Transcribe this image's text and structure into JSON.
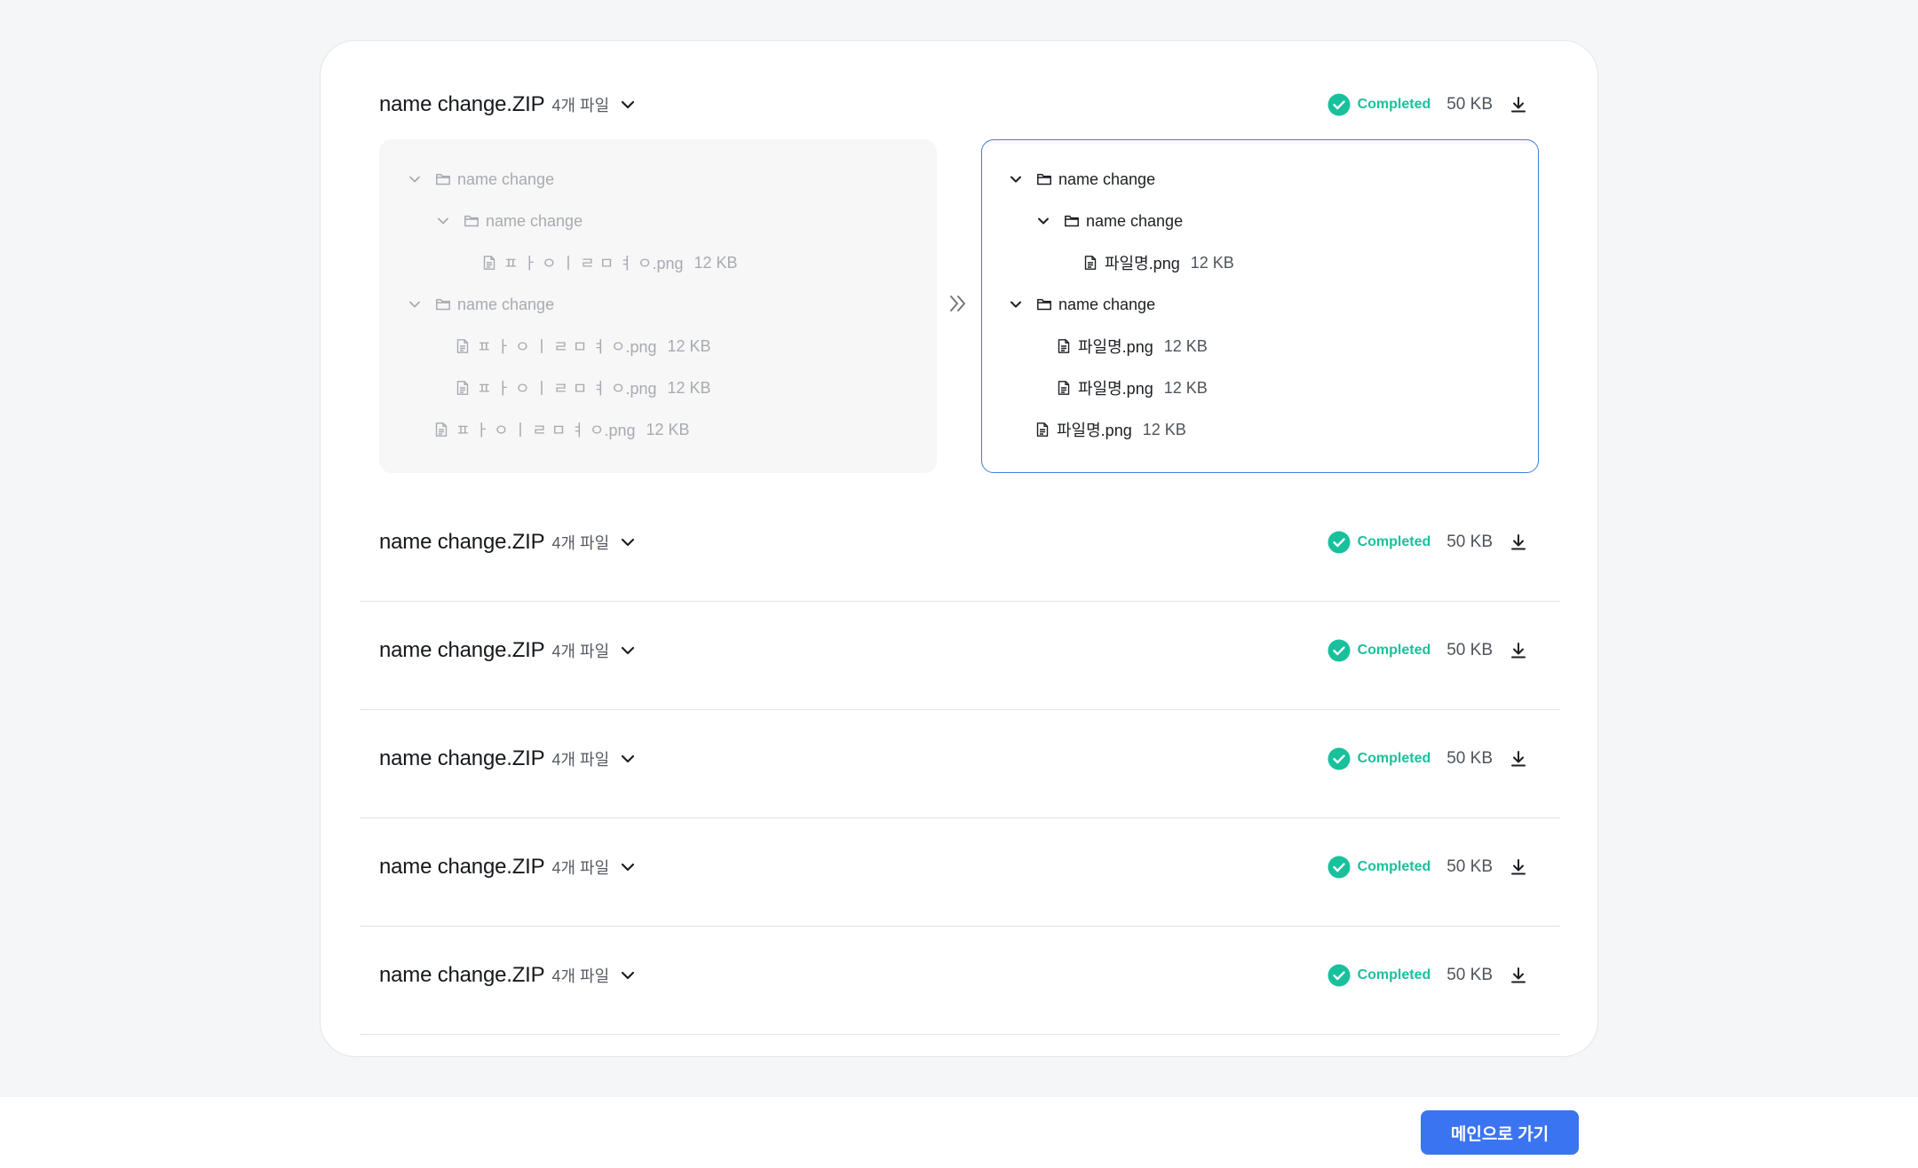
{
  "colors": {
    "accent": "#3b74f0",
    "status_completed": "#18c19c",
    "selected_border": "#3f7de0"
  },
  "files": [
    {
      "name": "name change.ZIP",
      "count": "4개 파일",
      "status": "Completed",
      "size": "50 KB",
      "expanded": true
    },
    {
      "name": "name change.ZIP",
      "count": "4개 파일",
      "status": "Completed",
      "size": "50 KB",
      "expanded": false
    },
    {
      "name": "name change.ZIP",
      "count": "4개 파일",
      "status": "Completed",
      "size": "50 KB",
      "expanded": false
    },
    {
      "name": "name change.ZIP",
      "count": "4개 파일",
      "status": "Completed",
      "size": "50 KB",
      "expanded": false
    },
    {
      "name": "name change.ZIP",
      "count": "4개 파일",
      "status": "Completed",
      "size": "50 KB",
      "expanded": false
    },
    {
      "name": "name change.ZIP",
      "count": "4개 파일",
      "status": "Completed",
      "size": "50 KB",
      "expanded": false
    }
  ],
  "before_tree": [
    {
      "type": "folder",
      "label": "name change"
    },
    {
      "type": "folder",
      "label": "name change"
    },
    {
      "type": "file",
      "label": "ㅍ ㅏ ㅇ ㅣ ㄹ ㅁ ㅕ ㅇ.png",
      "size": "12 KB"
    },
    {
      "type": "folder",
      "label": "name change"
    },
    {
      "type": "file",
      "label": "ㅍ ㅏ ㅇ ㅣ ㄹ ㅁ ㅕ ㅇ.png",
      "size": "12 KB"
    },
    {
      "type": "file",
      "label": "ㅍ ㅏ ㅇ ㅣ ㄹ ㅁ ㅕ ㅇ.png",
      "size": "12 KB"
    },
    {
      "type": "file",
      "label": "ㅍ ㅏ ㅇ ㅣ ㄹ ㅁ ㅕ ㅇ.png",
      "size": "12 KB"
    }
  ],
  "after_tree": [
    {
      "type": "folder",
      "label": "name change"
    },
    {
      "type": "folder",
      "label": "name change"
    },
    {
      "type": "file",
      "label": "파일명.png",
      "size": "12 KB"
    },
    {
      "type": "folder",
      "label": "name change"
    },
    {
      "type": "file",
      "label": "파일명.png",
      "size": "12 KB"
    },
    {
      "type": "file",
      "label": "파일명.png",
      "size": "12 KB"
    },
    {
      "type": "file",
      "label": "파일명.png",
      "size": "12 KB"
    }
  ],
  "footer": {
    "main_button_label": "메인으로 가기"
  }
}
